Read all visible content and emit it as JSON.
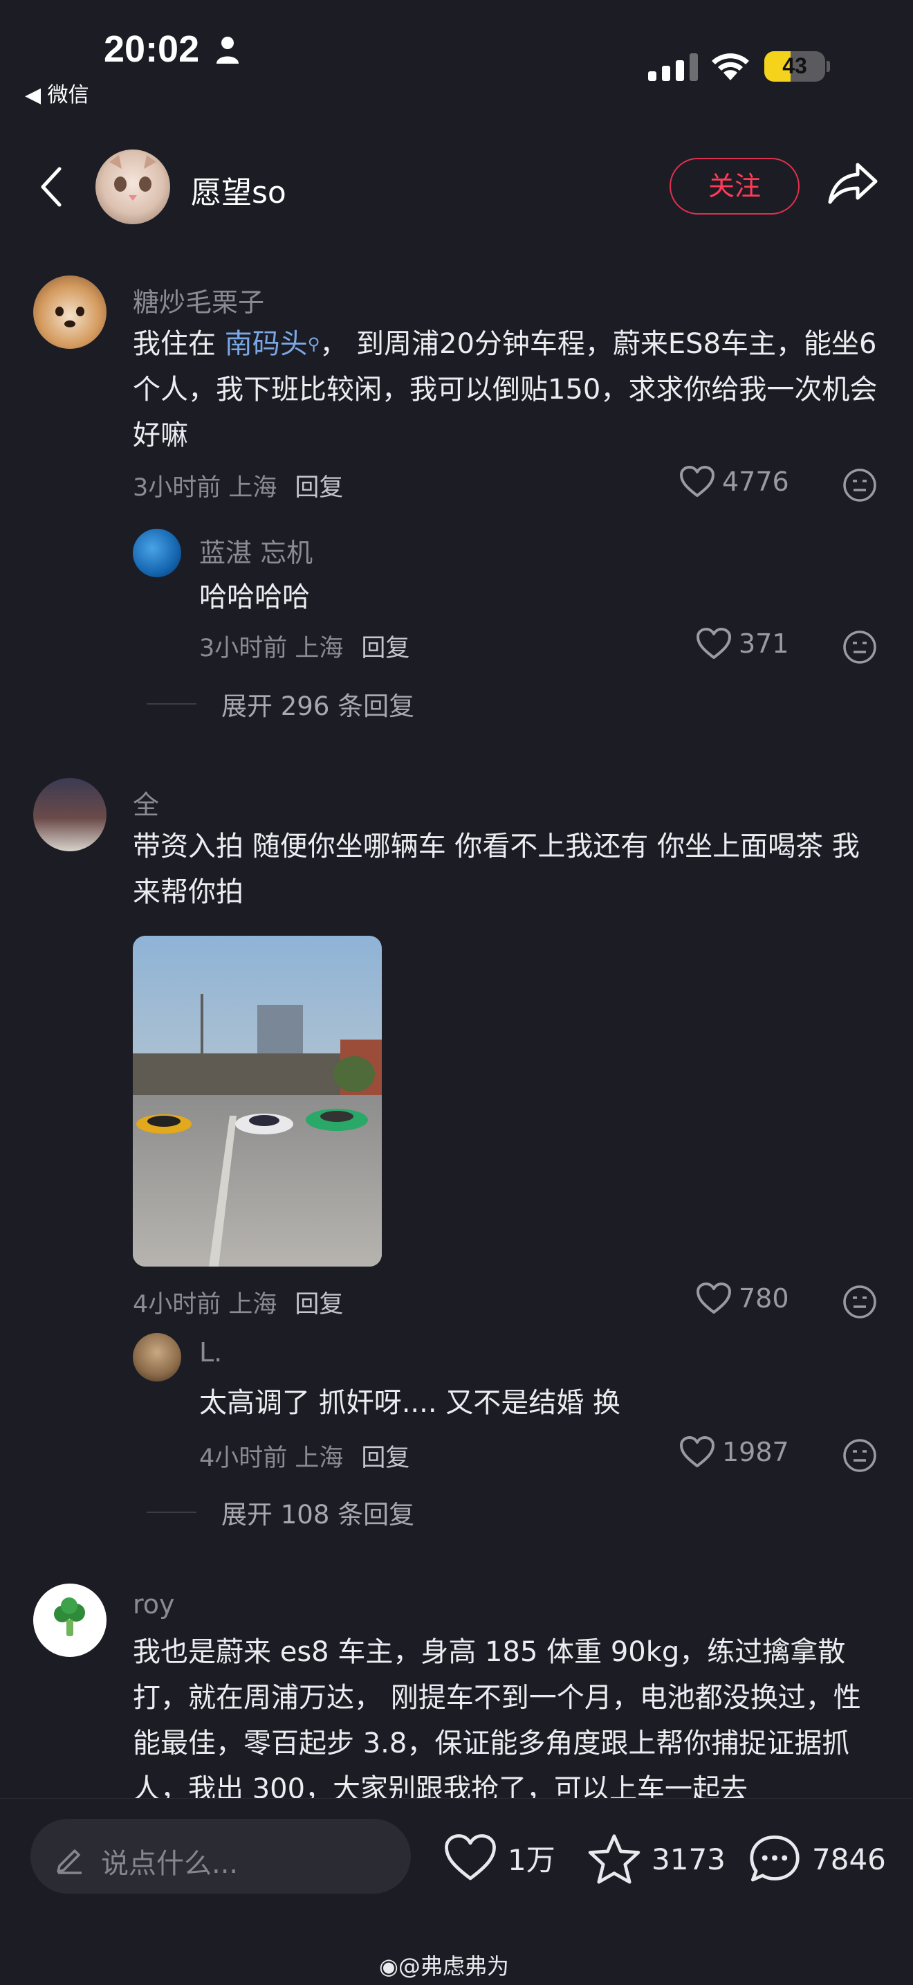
{
  "status_bar": {
    "time": "20:02",
    "back_app": "◀ 微信",
    "battery": "43"
  },
  "header": {
    "username": "愿望so",
    "follow_label": "关注"
  },
  "comments": [
    {
      "username": "糖炒毛栗子",
      "text_before_link": "我住在 ",
      "link": "南码头",
      "text_after_link": "， 到周浦20分钟车程，蔚来ES8车主，能坐6个人，我下班比较闲，我可以倒贴150，求求你给我一次机会好嘛",
      "meta": "3小时前 上海",
      "reply_label": "回复",
      "likes": "4776",
      "reply": {
        "username": "蓝湛 忘机",
        "text": "哈哈哈哈",
        "meta": "3小时前 上海",
        "reply_label": "回复",
        "likes": "371"
      },
      "expand": "展开 296 条回复"
    },
    {
      "username": "全",
      "text": "带资入拍 随便你坐哪辆车 你看不上我还有 你坐上面喝茶 我来帮你拍",
      "meta": "4小时前 上海",
      "reply_label": "回复",
      "likes": "780",
      "reply": {
        "username": "L.",
        "text": "太高调了 抓奸呀.... 又不是结婚 换",
        "meta": "4小时前 上海",
        "reply_label": "回复",
        "likes": "1987"
      },
      "expand": "展开 108 条回复"
    },
    {
      "username": "roy",
      "text": "我也是蔚来 es8 车主，身高 185 体重 90kg，练过擒拿散打，就在周浦万达， 刚提车不到一个月，电池都没换过，性能最佳，零百起步 3.8，保证能多角度跟上帮你捕捉证据抓人，我出 300，大家别跟我抢了，可以上车一起去"
    }
  ],
  "bottom_bar": {
    "input_placeholder": "说点什么...",
    "likes": "1万",
    "favorites": "3173",
    "comments": "7846"
  },
  "watermark": "@弗虑弗为",
  "colors": {
    "background": "#1c1c24",
    "accent": "#ff3b57",
    "link": "#7aa8e6"
  }
}
